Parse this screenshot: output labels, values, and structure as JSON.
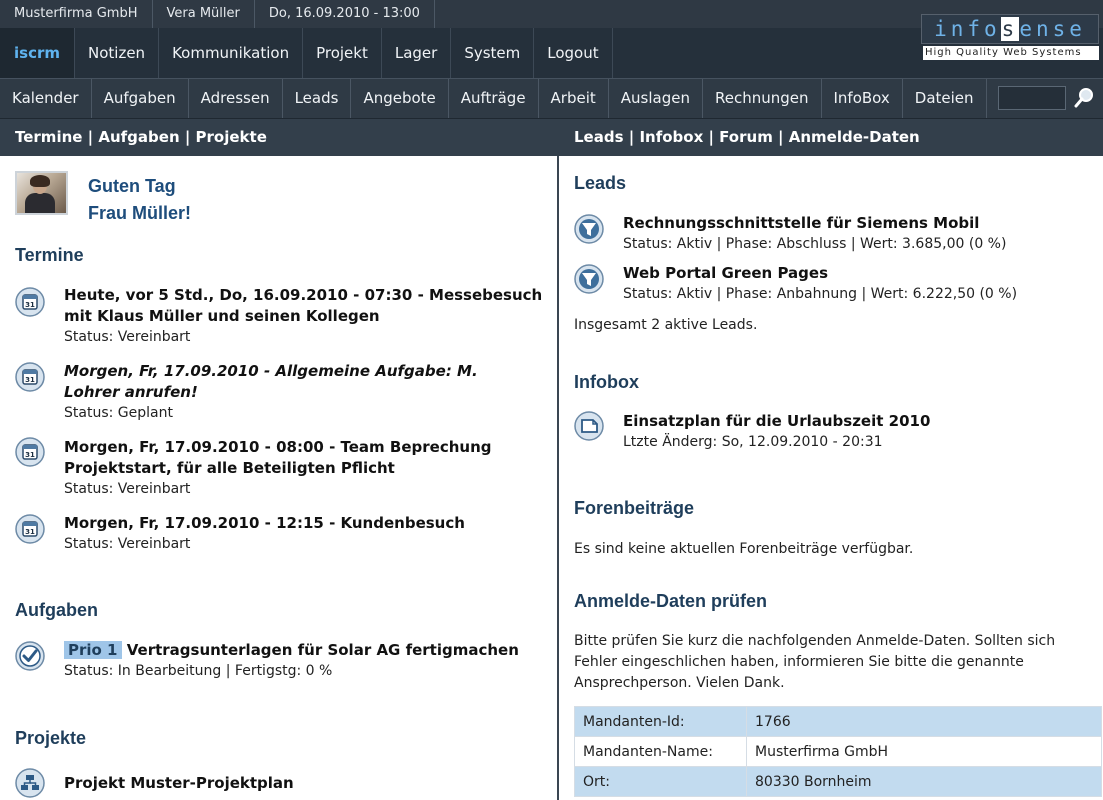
{
  "infobar": {
    "company": "Musterfirma GmbH",
    "user": "Vera Müller",
    "datetime": "Do, 16.09.2010 - 13:00"
  },
  "logo": {
    "word_pre": "info",
    "word_hl": "s",
    "word_post": "ense",
    "tagline": "High Quality Web Systems"
  },
  "mainnav": [
    "iscrm",
    "Notizen",
    "Kommunikation",
    "Projekt",
    "Lager",
    "System",
    "Logout"
  ],
  "subnav": [
    "Kalender",
    "Aufgaben",
    "Adressen",
    "Leads",
    "Angebote",
    "Aufträge",
    "Arbeit",
    "Auslagen",
    "Rechnungen",
    "InfoBox",
    "Dateien"
  ],
  "section_header": {
    "left": "Termine | Aufgaben | Projekte",
    "right": "Leads | Infobox | Forum | Anmelde-Daten"
  },
  "greeting": {
    "line1": "Guten Tag",
    "line2": "Frau Müller!"
  },
  "termine": {
    "heading": "Termine",
    "items": [
      {
        "title": "Heute, vor 5 Std., Do, 16.09.2010 - 07:30 - Messebesuch mit Klaus Müller und seinen Kollegen",
        "status": "Status: Vereinbart"
      },
      {
        "title": "Morgen, Fr, 17.09.2010 - Allgemeine Aufgabe: M. Lohrer anrufen!",
        "status": "Status: Geplant"
      },
      {
        "title": "Morgen, Fr, 17.09.2010 - 08:00 - Team Beprechung Projektstart, für alle Beteiligten Pflicht",
        "status": "Status: Vereinbart"
      },
      {
        "title": "Morgen, Fr, 17.09.2010 - 12:15 - Kundenbesuch",
        "status": "Status: Vereinbart"
      }
    ]
  },
  "aufgaben": {
    "heading": "Aufgaben",
    "items": [
      {
        "prio": "Prio 1",
        "title": "Vertragsunterlagen für Solar AG fertigmachen",
        "status": "Status: In Bearbeitung | Fertigstg: 0 %"
      }
    ]
  },
  "projekte": {
    "heading": "Projekte",
    "items": [
      {
        "title": "Projekt Muster-Projektplan"
      }
    ]
  },
  "leads": {
    "heading": "Leads",
    "items": [
      {
        "title": "Rechnungsschnittstelle für Siemens Mobil",
        "status": "Status: Aktiv | Phase: Abschluss | Wert: 3.685,00 (0 %)"
      },
      {
        "title": "Web Portal Green Pages",
        "status": "Status: Aktiv | Phase: Anbahnung | Wert: 6.222,50 (0 %)"
      }
    ],
    "summary": "Insgesamt 2 aktive Leads."
  },
  "infobox": {
    "heading": "Infobox",
    "items": [
      {
        "title": "Einsatzplan für die Urlaubszeit 2010",
        "status": "Ltzte Änderg: So, 12.09.2010 - 20:31"
      }
    ]
  },
  "foren": {
    "heading": "Forenbeiträge",
    "text": "Es sind keine aktuellen Forenbeiträge verfügbar."
  },
  "anmelde": {
    "heading": "Anmelde-Daten prüfen",
    "text_lines": [
      "Bitte prüfen Sie kurz die nachfolgenden Anmelde-Daten. Sollten sich",
      "Fehler eingeschlichen haben, informieren Sie bitte die genannte",
      "Ansprechperson. Vielen Dank."
    ],
    "rows": [
      {
        "key": "Mandanten-Id:",
        "value": "1766"
      },
      {
        "key": "Mandanten-Name:",
        "value": "Musterfirma GmbH"
      },
      {
        "key": "Ort:",
        "value": "80330 Bornheim"
      }
    ]
  },
  "colors": {
    "accent": "#5fb3ef",
    "heading": "#1f3e5b",
    "nav_bg": "#25303b",
    "table_alt": "#c2dbef"
  }
}
